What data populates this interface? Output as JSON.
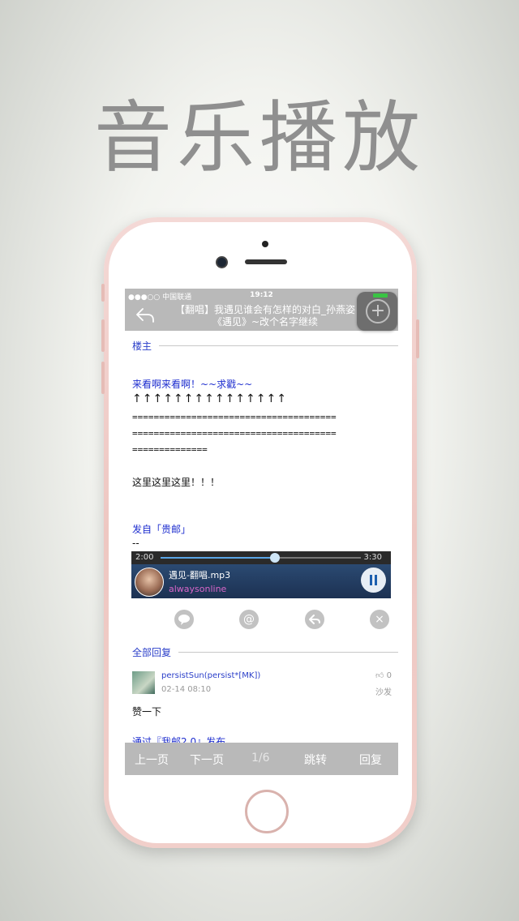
{
  "hero": {
    "title": "音乐播放"
  },
  "status_bar": {
    "carrier": "●●●○○ 中国联通",
    "time": "19:12"
  },
  "nav": {
    "title_line1": "【翻唱】我遇见谁会有怎样的对白_孙燕姿",
    "title_line2": "《遇见》~改个名字继续"
  },
  "post": {
    "owner_label": "楼主",
    "headline": "来看啊来看啊！~~求戳~~",
    "arrows": "↑↑↑↑↑↑↑↑↑↑↑↑↑↑↑",
    "eq_line1": "======================================",
    "eq_line2": "======================================",
    "eq_line3": "==============",
    "body": "这里这里这里！！！",
    "source": "发自「贵邮」",
    "separator": "--"
  },
  "player": {
    "current_time": "2:00",
    "total_time": "3:30",
    "progress": 0.57,
    "song": "遇见-翻唱.mp3",
    "artist": "alwaysonline"
  },
  "actions": {
    "comment_icon": "speech-bubble-icon",
    "at_icon": "@",
    "reply_icon": "reply-arrow-icon",
    "close_icon": "×"
  },
  "replies": {
    "section_label": "全部回复",
    "items": [
      {
        "name": "persistSun(persist*[MK])",
        "time": "02-14 08:10",
        "likes": "0",
        "floor": "沙发",
        "text": "赞一下"
      }
    ],
    "footer_link": "通过『我邮2.0』发布"
  },
  "bottom_bar": {
    "prev": "上一页",
    "next": "下一页",
    "page": "1/6",
    "jump": "跳转",
    "reply": "回复"
  },
  "colors": {
    "accent_blue": "#1f2fcf",
    "bar_gray": "#b9b9b9",
    "phone_rose": "#eec7c2"
  }
}
